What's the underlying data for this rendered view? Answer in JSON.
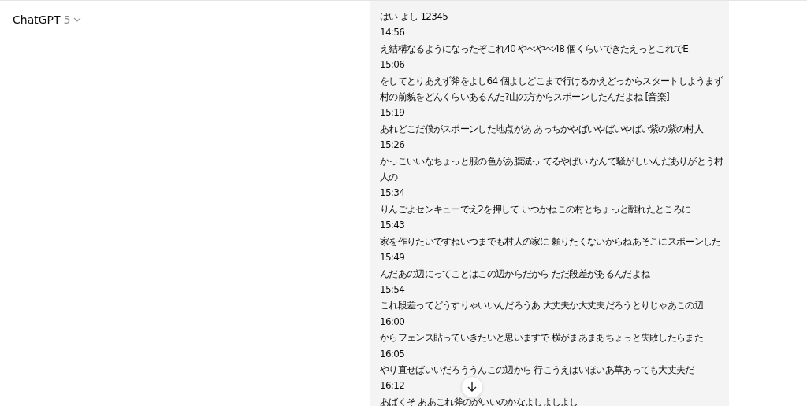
{
  "header": {
    "model_name": "ChatGPT",
    "model_version": "5"
  },
  "transcript": [
    {
      "text": "はい よし 12345"
    },
    {
      "time": "14:56",
      "text": "え結構なるようになったぞこれ40 やべやべ48 個くらいできたえっとこれでE"
    },
    {
      "time": "15:06",
      "text": "をしてとりあえず斧をよし64 個よしどこまで行けるかえどっからスタートしようまず村の前貌をどんくらいあるんだ?山の方からスポーンしたんだよね [音楽]"
    },
    {
      "time": "15:19",
      "text": "あれどこだ僕がスポーンした地点があ あっちかやばいやばいやばい紫の紫の村人"
    },
    {
      "time": "15:26",
      "text": "かっこいいなちょっと服の色があ腹減っ てるやばい なんて騒がしいんだありがとう村人の"
    },
    {
      "time": "15:34",
      "text": "りんごよセンキューでえ2を押して いつかねこの村とちょっと離れたところに"
    },
    {
      "time": "15:43",
      "text": "家を作りたいですねいつまでも村人の家に 頼りたくないからねあそこにスポーンした"
    },
    {
      "time": "15:49",
      "text": "んだあの辺にってことはこの辺からだから ただ段差があるんだよね"
    },
    {
      "time": "15:54",
      "text": "これ段差ってどうすりゃいいんだろうあ 大丈夫か大丈夫だろうとりじゃあこの辺"
    },
    {
      "time": "16:00",
      "text": "からフェンス貼っていきたいと思いますで 横がまあまあちょっと失敗したらまた"
    },
    {
      "time": "16:05",
      "text": "やり直せばいいだろううんこの辺から 行こうえはいほいあ草あっても大丈夫だ"
    },
    {
      "time": "16:12",
      "text": "あばくそ ああこれ斧のがいいのかなよしよしよし"
    }
  ]
}
